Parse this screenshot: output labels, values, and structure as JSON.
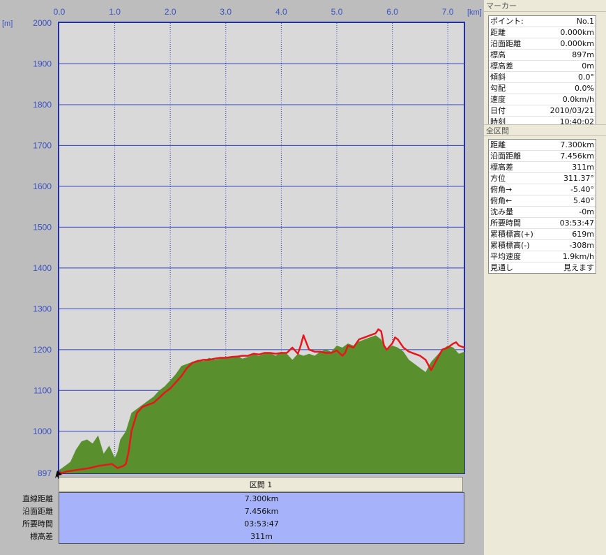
{
  "chart_data": {
    "type": "area",
    "x_unit": "[km]",
    "y_unit": "[m]",
    "xlim": [
      0,
      7.3
    ],
    "ylim": [
      897,
      2000
    ],
    "x_ticks": [
      "0.0",
      "1.0",
      "2.0",
      "3.0",
      "4.0",
      "5.0",
      "6.0",
      "7.0"
    ],
    "y_ticks": [
      "2000",
      "1900",
      "1800",
      "1700",
      "1600",
      "1500",
      "1400",
      "1300",
      "1200",
      "1100",
      "1000",
      "897"
    ],
    "grid": true,
    "colors": {
      "terrain": "#5a8f2e",
      "track": "#e8161b",
      "grid": "#2d3fc0",
      "plot_bg": "#d9d9d9"
    },
    "series": [
      {
        "kind": "terrain",
        "x": [
          0,
          0.1,
          0.2,
          0.3,
          0.4,
          0.5,
          0.6,
          0.7,
          0.8,
          0.9,
          1.0,
          1.05,
          1.1,
          1.2,
          1.3,
          1.4,
          1.5,
          1.6,
          1.7,
          1.8,
          1.9,
          2.0,
          2.1,
          2.2,
          2.3,
          2.4,
          2.5,
          2.6,
          2.7,
          2.8,
          2.9,
          3.0,
          3.1,
          3.2,
          3.3,
          3.4,
          3.5,
          3.6,
          3.7,
          3.8,
          3.9,
          4.0,
          4.1,
          4.2,
          4.3,
          4.4,
          4.5,
          4.6,
          4.7,
          4.8,
          4.9,
          5.0,
          5.1,
          5.2,
          5.3,
          5.4,
          5.5,
          5.6,
          5.7,
          5.8,
          5.9,
          6.0,
          6.1,
          6.2,
          6.3,
          6.4,
          6.5,
          6.6,
          6.7,
          6.8,
          6.9,
          7.0,
          7.1,
          7.2,
          7.3
        ],
        "y": [
          905,
          915,
          925,
          955,
          975,
          980,
          970,
          990,
          945,
          965,
          935,
          950,
          980,
          1000,
          1045,
          1055,
          1065,
          1075,
          1085,
          1100,
          1110,
          1125,
          1140,
          1160,
          1165,
          1170,
          1175,
          1172,
          1180,
          1175,
          1178,
          1180,
          1182,
          1185,
          1178,
          1182,
          1188,
          1185,
          1190,
          1192,
          1185,
          1195,
          1190,
          1175,
          1190,
          1185,
          1190,
          1185,
          1195,
          1200,
          1195,
          1210,
          1205,
          1215,
          1210,
          1220,
          1225,
          1230,
          1235,
          1225,
          1200,
          1210,
          1205,
          1195,
          1175,
          1165,
          1155,
          1145,
          1170,
          1185,
          1200,
          1210,
          1205,
          1190,
          1195
        ]
      },
      {
        "kind": "track",
        "x": [
          0,
          0.05,
          0.15,
          0.3,
          0.45,
          0.55,
          0.7,
          0.85,
          0.95,
          1.05,
          1.15,
          1.2,
          1.25,
          1.3,
          1.4,
          1.5,
          1.6,
          1.7,
          1.8,
          1.9,
          2.0,
          2.1,
          2.2,
          2.3,
          2.4,
          2.5,
          2.6,
          2.7,
          2.8,
          2.9,
          3.0,
          3.1,
          3.2,
          3.3,
          3.4,
          3.5,
          3.6,
          3.7,
          3.8,
          3.9,
          4.0,
          4.1,
          4.2,
          4.3,
          4.35,
          4.4,
          4.5,
          4.6,
          4.7,
          4.8,
          4.9,
          5.0,
          5.1,
          5.15,
          5.2,
          5.3,
          5.4,
          5.5,
          5.6,
          5.7,
          5.75,
          5.8,
          5.85,
          5.9,
          6.0,
          6.05,
          6.1,
          6.2,
          6.3,
          6.4,
          6.5,
          6.6,
          6.7,
          6.8,
          6.9,
          7.0,
          7.1,
          7.15,
          7.2,
          7.3
        ],
        "y": [
          900,
          898,
          902,
          905,
          908,
          910,
          915,
          918,
          920,
          910,
          915,
          920,
          950,
          1000,
          1045,
          1060,
          1065,
          1070,
          1082,
          1095,
          1105,
          1120,
          1135,
          1155,
          1168,
          1172,
          1175,
          1175,
          1178,
          1180,
          1180,
          1182,
          1183,
          1185,
          1185,
          1190,
          1188,
          1192,
          1192,
          1190,
          1192,
          1192,
          1205,
          1190,
          1210,
          1235,
          1200,
          1195,
          1195,
          1192,
          1192,
          1198,
          1185,
          1192,
          1210,
          1205,
          1225,
          1230,
          1235,
          1240,
          1250,
          1245,
          1210,
          1200,
          1215,
          1230,
          1225,
          1205,
          1195,
          1190,
          1185,
          1175,
          1150,
          1175,
          1200,
          1205,
          1215,
          1218,
          1210,
          1205
        ]
      }
    ]
  },
  "section": {
    "header": "区間 1",
    "rows": [
      {
        "label": "直線距離",
        "value": "7.300km"
      },
      {
        "label": "沿面距離",
        "value": "7.456km"
      },
      {
        "label": "所要時間",
        "value": "03:53:47"
      },
      {
        "label": "標高差",
        "value": "311m"
      }
    ]
  },
  "marker": {
    "title": "マーカー",
    "rows": [
      {
        "key": "ポイント:",
        "value": "No.1"
      },
      {
        "key": "距離",
        "value": "0.000km"
      },
      {
        "key": "沿面距離",
        "value": "0.000km"
      },
      {
        "key": "標高",
        "value": "897m"
      },
      {
        "key": "標高差",
        "value": "0m"
      },
      {
        "key": "傾斜",
        "value": "0.0°"
      },
      {
        "key": "勾配",
        "value": "0.0%"
      },
      {
        "key": "速度",
        "value": "0.0km/h"
      },
      {
        "key": "日付",
        "value": "2010/03/21"
      },
      {
        "key": "時刻",
        "value": "10:40:02"
      }
    ]
  },
  "all_section": {
    "title": "全区間",
    "rows": [
      {
        "key": "距離",
        "value": "7.300km"
      },
      {
        "key": "沿面距離",
        "value": "7.456km"
      },
      {
        "key": "標高差",
        "value": "311m"
      },
      {
        "key": "方位",
        "value": "311.37°"
      },
      {
        "key": "俯角→",
        "value": "-5.40°"
      },
      {
        "key": "俯角←",
        "value": "5.40°"
      },
      {
        "key": "沈み量",
        "value": "-0m"
      },
      {
        "key": "所要時間",
        "value": "03:53:47"
      },
      {
        "key": "累積標高(+)",
        "value": "619m"
      },
      {
        "key": "累積標高(-)",
        "value": "-308m"
      },
      {
        "key": "平均速度",
        "value": "1.9km/h"
      },
      {
        "key": "見通し",
        "value": "見えます"
      }
    ]
  }
}
